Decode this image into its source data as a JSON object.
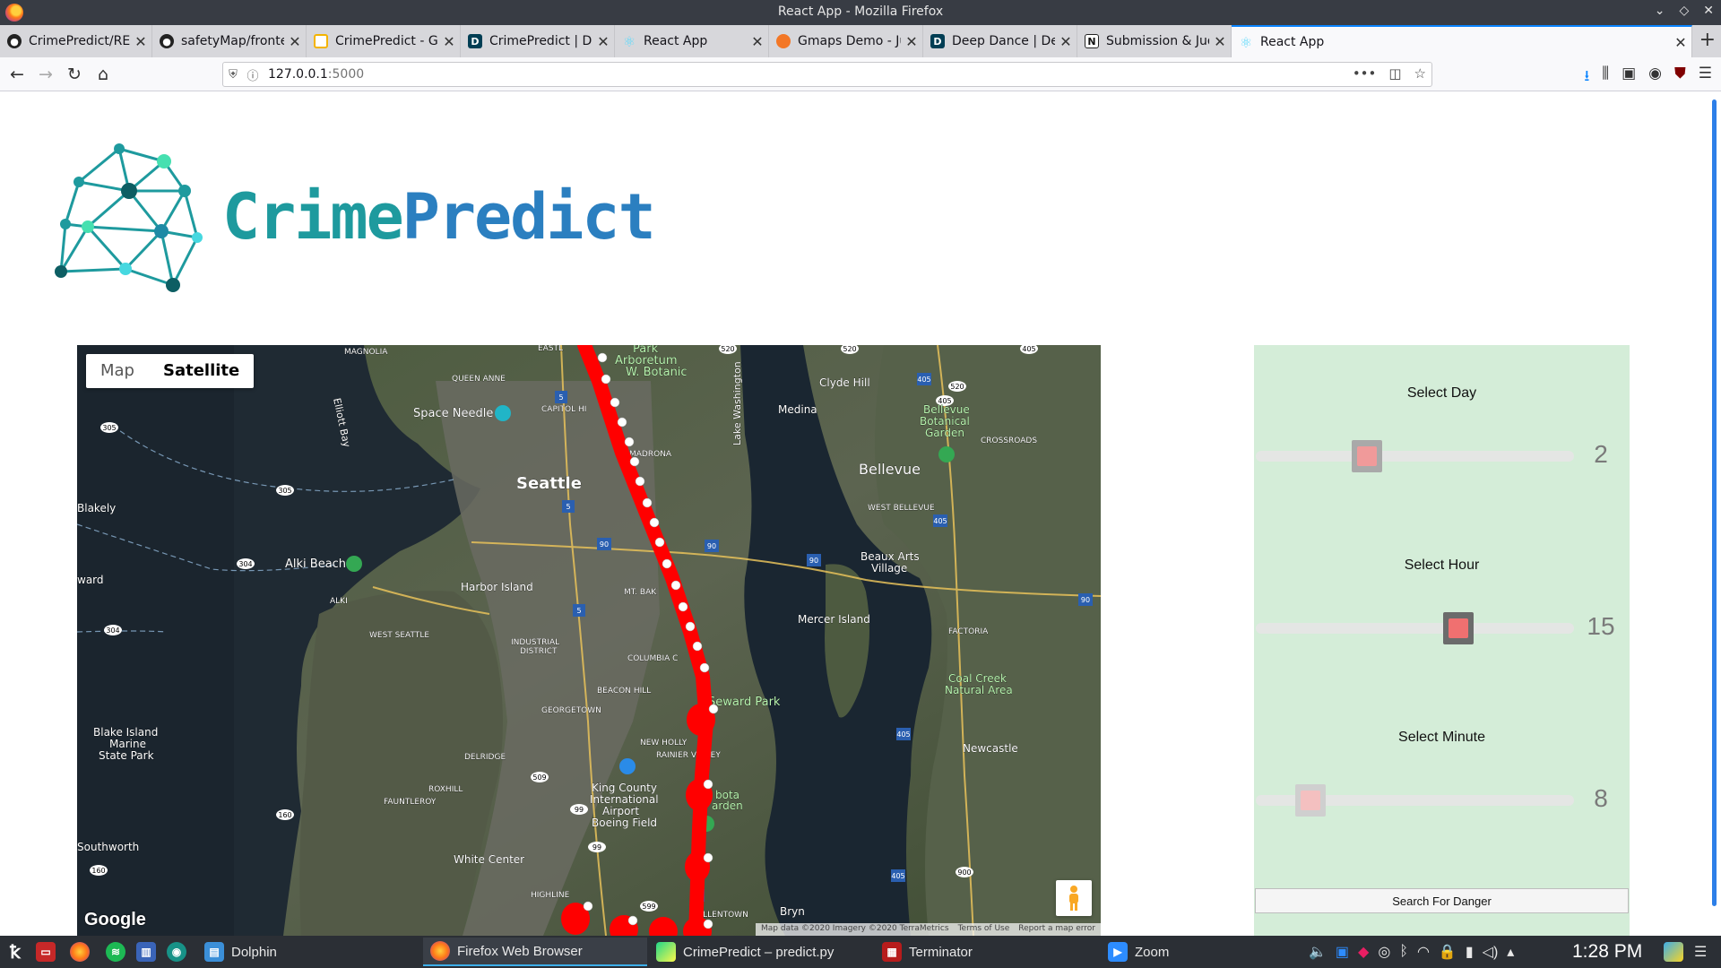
{
  "window": {
    "title": "React App - Mozilla Firefox",
    "controls": [
      "⌄",
      "◇",
      "✕"
    ]
  },
  "tabs": [
    {
      "label": "CrimePredict/README.r",
      "favicon": "github-icon",
      "active": false
    },
    {
      "label": "safetyMap/frontend at",
      "favicon": "github-icon",
      "active": false
    },
    {
      "label": "CrimePredict - Google S",
      "favicon": "slides-icon",
      "active": false
    },
    {
      "label": "CrimePredict | Devpost",
      "favicon": "devpost-icon",
      "active": false
    },
    {
      "label": "React App",
      "favicon": "react-icon",
      "active": false
    },
    {
      "label": "Gmaps Demo - Jupyter",
      "favicon": "jupyter-icon",
      "active": false
    },
    {
      "label": "Deep Dance | Devpost",
      "favicon": "devpost-icon",
      "active": false
    },
    {
      "label": "Submission & Judging",
      "favicon": "notion-icon",
      "active": false
    },
    {
      "label": "React App",
      "favicon": "react-icon",
      "active": true
    }
  ],
  "tab_close": "✕",
  "new_tab": "+",
  "nav": {
    "url_host": "127.0.0.1",
    "url_port": ":5000",
    "back": "←",
    "forward": "→",
    "reload": "↻",
    "home": "⌂",
    "page_actions": "•••",
    "pocket": "◫",
    "bookmark": "☆"
  },
  "brand": {
    "part1": "Crime",
    "part2": "Predict",
    "color1": "#1e9a9e",
    "color2": "#2b7fc0"
  },
  "map": {
    "type_buttons": [
      "Map",
      "Satellite"
    ],
    "selected_type": "Satellite",
    "google": "Google",
    "attribution": [
      "Map data ©2020 Imagery ©2020 TerraMetrics",
      "Terms of Use",
      "Report a map error"
    ],
    "route_color": "#ff0000",
    "labels": [
      {
        "text": "MAGNOLIA",
        "cls": "s"
      },
      {
        "text": "QUEEN ANNE",
        "cls": "s"
      },
      {
        "text": "Space Needle",
        "cls": "m"
      },
      {
        "text": "Seattle",
        "cls": "l"
      },
      {
        "text": "CAPITOL HI",
        "cls": "s"
      },
      {
        "text": "Arboretum",
        "cls": "m"
      },
      {
        "text": "W. Botanic",
        "cls": "m"
      },
      {
        "text": "Lake Washington",
        "cls": "m"
      },
      {
        "text": "Clyde Hill",
        "cls": "m"
      },
      {
        "text": "Medina",
        "cls": "m"
      },
      {
        "text": "Bellevue",
        "cls": "m"
      },
      {
        "text": "Botanical",
        "cls": "m"
      },
      {
        "text": "Garden",
        "cls": "m"
      },
      {
        "text": "CROSSROADS",
        "cls": "s"
      },
      {
        "text": "Bellevue",
        "cls": "l"
      },
      {
        "text": "WEST BELLEVUE",
        "cls": "s"
      },
      {
        "text": "Beaux Arts",
        "cls": "m"
      },
      {
        "text": "Village",
        "cls": "m"
      },
      {
        "text": "Elliott Bay",
        "cls": "m"
      },
      {
        "text": "Blakely",
        "cls": "m"
      },
      {
        "text": "Alki Beach",
        "cls": "m"
      },
      {
        "text": "ALKI",
        "cls": "s"
      },
      {
        "text": "Harbor Island",
        "cls": "m"
      },
      {
        "text": "WEST SEATTLE",
        "cls": "s"
      },
      {
        "text": "INDUSTRIAL",
        "cls": "s"
      },
      {
        "text": "DISTRICT",
        "cls": "s"
      },
      {
        "text": "MT. BAK",
        "cls": "s"
      },
      {
        "text": "COLUMBIA C",
        "cls": "s"
      },
      {
        "text": "BEACON HILL",
        "cls": "s"
      },
      {
        "text": "Mercer Island",
        "cls": "m"
      },
      {
        "text": "FACTORIA",
        "cls": "s"
      },
      {
        "text": "Seward Park",
        "cls": "m"
      },
      {
        "text": "Coal Creek",
        "cls": "m"
      },
      {
        "text": "Natural Area",
        "cls": "m"
      },
      {
        "text": "GEORGETOWN",
        "cls": "s"
      },
      {
        "text": "NEW HOLLY",
        "cls": "s"
      },
      {
        "text": "RAINIER VALLEY",
        "cls": "s"
      },
      {
        "text": "DELRIDGE",
        "cls": "s"
      },
      {
        "text": "Blake Island",
        "cls": "m"
      },
      {
        "text": "Marine",
        "cls": "m"
      },
      {
        "text": "State Park",
        "cls": "m"
      },
      {
        "text": "Newcastle",
        "cls": "m"
      },
      {
        "text": "ROXHILL",
        "cls": "s"
      },
      {
        "text": "FAUNTLEROY",
        "cls": "s"
      },
      {
        "text": "King County",
        "cls": "m"
      },
      {
        "text": "International",
        "cls": "m"
      },
      {
        "text": "Airport",
        "cls": "m"
      },
      {
        "text": "Boeing Field",
        "cls": "m"
      },
      {
        "text": "bota",
        "cls": "m"
      },
      {
        "text": "arden",
        "cls": "m"
      },
      {
        "text": "Southworth",
        "cls": "m"
      },
      {
        "text": "White Center",
        "cls": "m"
      },
      {
        "text": "HIGHLINE",
        "cls": "s"
      },
      {
        "text": "ALLENTOWN",
        "cls": "s"
      },
      {
        "text": "Bryn",
        "cls": "m"
      },
      {
        "text": "ward",
        "cls": "m"
      },
      {
        "text": "EASTL",
        "cls": "s"
      },
      {
        "text": "Park",
        "cls": "m"
      },
      {
        "text": "MADRONA",
        "cls": "s"
      }
    ],
    "shields": [
      "305",
      "305",
      "304",
      "304",
      "160",
      "160",
      "5",
      "5",
      "5",
      "5",
      "90",
      "90",
      "90",
      "90",
      "520",
      "520",
      "520",
      "405",
      "405",
      "405",
      "405",
      "405",
      "405",
      "900",
      "509",
      "99",
      "99",
      "599"
    ]
  },
  "controls": {
    "day": {
      "label": "Select Day",
      "value": "2",
      "min": 0,
      "max": 6,
      "thumb_fill": "#f09a9a",
      "thumb_border": "#a9a9a9"
    },
    "hour": {
      "label": "Select Hour",
      "value": "15",
      "min": 0,
      "max": 23,
      "thumb_fill": "#f07070",
      "thumb_border": "#6b6b6b"
    },
    "minute": {
      "label": "Select Minute",
      "value": "8",
      "min": 0,
      "max": 59,
      "thumb_fill": "#f4c0c0",
      "thumb_border": "#cfcfcf"
    },
    "search_label": "Search For Danger"
  },
  "taskbar": {
    "launchers": [
      "kde-menu-icon",
      "terminal-icon",
      "firefox-icon",
      "spotify-icon",
      "jira-icon",
      "gitkraken-icon"
    ],
    "tasks": [
      {
        "label": "Dolphin",
        "icon": "dolphin-icon"
      },
      {
        "label": "Firefox Web Browser",
        "icon": "firefox-icon",
        "active": true
      },
      {
        "label": "CrimePredict – predict.py",
        "icon": "pycharm-icon"
      },
      {
        "label": "Terminator",
        "icon": "terminator-icon"
      },
      {
        "label": "Zoom",
        "icon": "zoom-icon"
      }
    ],
    "tray": [
      "volume-icon",
      "zoom-tray-icon",
      "jetbrains-icon",
      "steam-icon",
      "bluetooth-icon",
      "wifi-icon",
      "lock-icon",
      "battery-icon",
      "speaker-icon",
      "expand-tray-icon"
    ],
    "clock": "1:28 PM"
  }
}
